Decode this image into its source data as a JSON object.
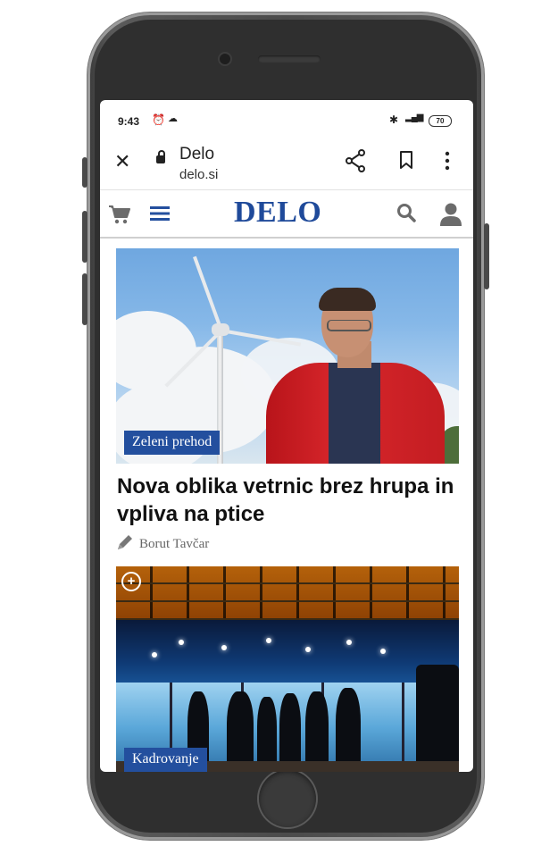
{
  "status_bar": {
    "time": "9:43",
    "alarm_icon": "alarm-icon",
    "cloud_icon": "cloud-icon",
    "bluetooth_icon": "bluetooth-icon",
    "signal_icon": "signal-icon",
    "battery": "70"
  },
  "browser": {
    "close_icon": "close-icon",
    "lock_icon": "lock-icon",
    "title": "Delo",
    "url": "delo.si",
    "share_icon": "share-icon",
    "bookmark_icon": "bookmark-icon",
    "more_icon": "more-vertical-icon"
  },
  "site_header": {
    "logo": "DELO",
    "logo_color": "#1f4a9a",
    "cart_icon": "cart-icon",
    "menu_icon": "hamburger-menu-icon",
    "search_icon": "search-icon",
    "user_icon": "user-icon"
  },
  "articles": [
    {
      "category": "Zeleni prehod",
      "headline": "Nova oblika vetrnic brez hrupa in vpliva na ptice",
      "author": "Borut Tavčar",
      "author_icon": "pen-icon"
    },
    {
      "category": "Kadrovanje",
      "badge_icon": "plus-circle-icon"
    }
  ],
  "accent_color": "#234f9e"
}
